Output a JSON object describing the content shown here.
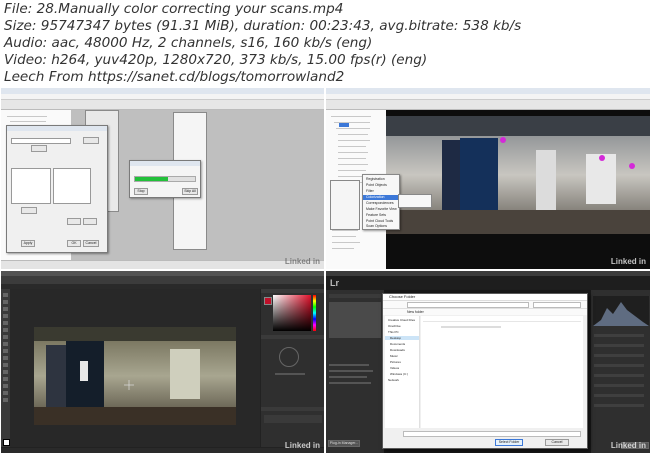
{
  "media_info": {
    "line1": "File: 28.Manually color correcting your scans.mp4",
    "line2": "Size: 95747347 bytes (91.31 MiB), duration: 00:23:43, avg.bitrate: 538 kb/s",
    "line3": "Audio: aac, 48000 Hz, 2 channels, s16, 160 kb/s (eng)",
    "line4": "Video: h264, yuv420p, 1280x720, 373 kb/s, 15.00 fps(r) (eng)",
    "line5": "Leech From https://sanet.cd/blogs/tomorrowland2"
  },
  "watermark": "Linked in",
  "colors": {
    "progress_green": "#22c03a",
    "ps_bg": "#323232",
    "lr_bg": "#2a2a2a",
    "highlight_blue": "#3c78d8"
  },
  "q1": {
    "dialog_ok": "OK",
    "dialog_cancel": "Cancel",
    "apply_label": "Apply",
    "small_dialog_stop": "Stop",
    "small_dialog_skip": "Skip All",
    "progress_fraction": 0.55
  },
  "q2": {
    "context_menu": [
      "Registration",
      "Point Objects",
      "Filter",
      "Colorization",
      "Correspondences",
      "Make Favorite View",
      "Feature Sets",
      "Point Cloud Tools",
      "Scan Options"
    ]
  },
  "q4": {
    "dialog_title": "Choose Folder",
    "new_folder_label": "New folder",
    "select_folder_label": "Select Folder",
    "cancel_label": "Cancel",
    "sidebar": [
      "Creative Cloud Files",
      "OneDrive",
      "This PC",
      "Desktop",
      "Documents",
      "Downloads",
      "Music",
      "Pictures",
      "Videos",
      "Windows (C:)",
      "Network"
    ],
    "import_label": "Plug-in Manager..."
  }
}
